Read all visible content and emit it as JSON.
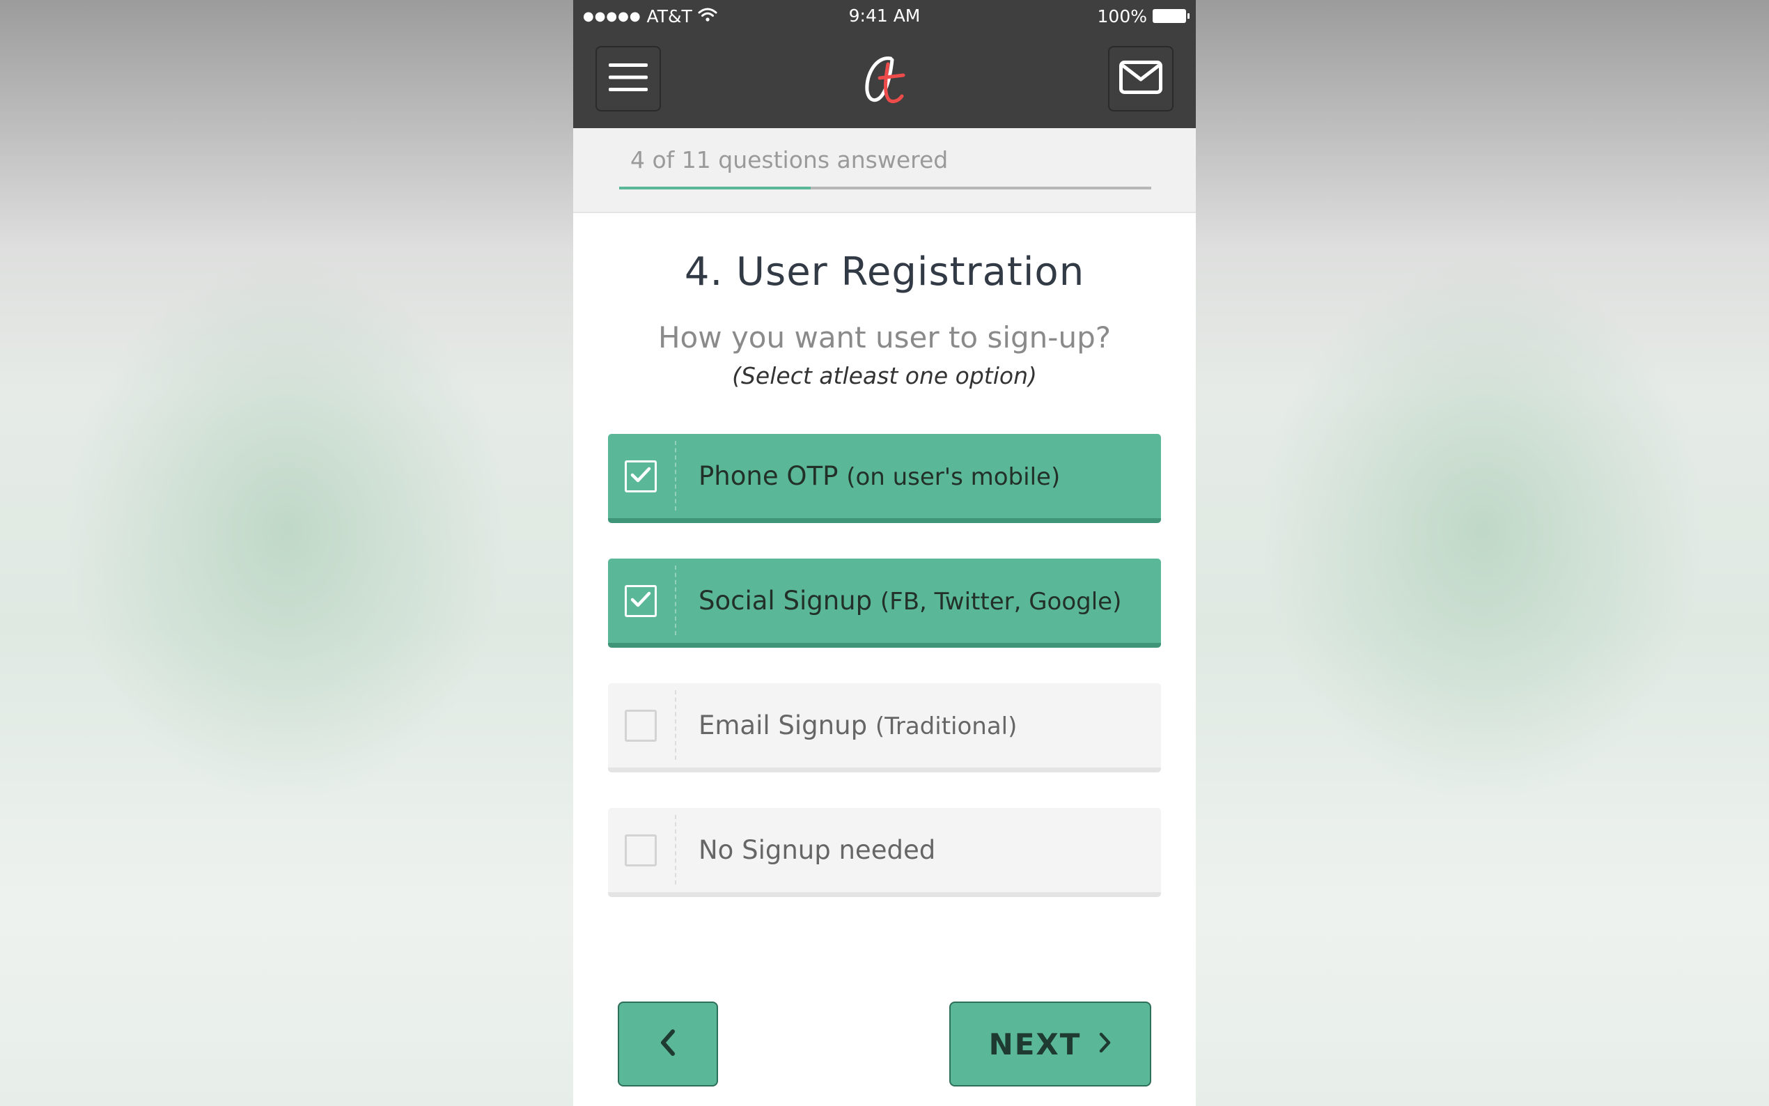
{
  "status_bar": {
    "carrier": "AT&T",
    "time": "9:41 AM",
    "battery": "100%"
  },
  "header": {
    "menu_icon": "hamburger-menu-icon",
    "logo_icon": "brand-logo",
    "mail_icon": "envelope-icon"
  },
  "progress": {
    "label": "4 of 11 questions answered",
    "answered": 4,
    "total": 11,
    "fraction": 0.36
  },
  "question": {
    "title": "4. User Registration",
    "subtitle": "How you want user to sign-up?",
    "hint": "(Select atleast one option)"
  },
  "options": [
    {
      "main": "Phone OTP",
      "detail": "(on user's mobile)",
      "checked": true
    },
    {
      "main": "Social Signup",
      "detail": "(FB, Twitter, Google)",
      "checked": true
    },
    {
      "main": "Email Signup",
      "detail": "(Traditional)",
      "checked": false
    },
    {
      "main": "No Signup needed",
      "detail": "",
      "checked": false
    }
  ],
  "navigation": {
    "back_icon": "chevron-left-icon",
    "next_label": "NEXT",
    "next_icon": "chevron-right-icon"
  },
  "colors": {
    "accent": "#5ab898",
    "header_bg": "#3f3f3f",
    "logo_red": "#ee4b4b"
  }
}
